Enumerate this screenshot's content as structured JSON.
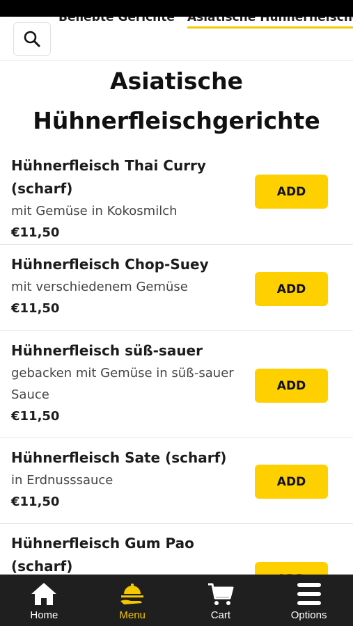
{
  "category_tabs": [
    {
      "label": "Beliebte Gerichte",
      "active": false
    },
    {
      "label": "Asiatische Hühnerfleischgerichte",
      "active": true
    }
  ],
  "section": {
    "title": "Asiatische Hühnerfleischgerichte"
  },
  "dishes": [
    {
      "name": "Hühnerfleisch Thai Curry (scharf)",
      "description": "mit Gemüse in Kokosmilch",
      "price": "€11,50",
      "button": "ADD"
    },
    {
      "name": "Hühnerfleisch Chop-Suey",
      "description": "mit verschiedenem Gemüse",
      "price": "€11,50",
      "button": "ADD"
    },
    {
      "name": "Hühnerfleisch süß-sauer",
      "description": "gebacken mit Gemüse in süß-sauer Sauce",
      "price": "€11,50",
      "button": "ADD"
    },
    {
      "name": "Hühnerfleisch Sate (scharf)",
      "description": "in Erdnusssauce",
      "price": "€11,50",
      "button": "ADD"
    },
    {
      "name": "Hühnerfleisch Gum Pao (scharf)",
      "description": "",
      "price": "",
      "button": "ADD"
    }
  ],
  "bottom_nav": [
    {
      "label": "Home",
      "icon": "home-icon",
      "active": false
    },
    {
      "label": "Menu",
      "icon": "serving-dish-icon",
      "active": true
    },
    {
      "label": "Cart",
      "icon": "cart-icon",
      "active": false
    },
    {
      "label": "Options",
      "icon": "hamburger-menu-icon",
      "active": false
    }
  ],
  "colors": {
    "accent": "#ffd000",
    "nav_background": "#1f1f1f",
    "nav_active": "#f6c800"
  }
}
